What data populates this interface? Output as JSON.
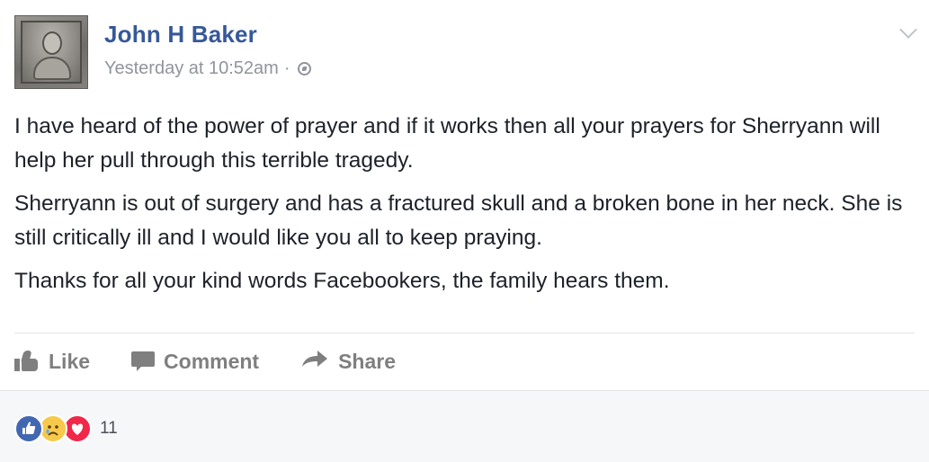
{
  "post": {
    "author_name": "John H Baker",
    "timestamp": "Yesterday at 10:52am",
    "separator": "·",
    "audience_icon": "globe-icon",
    "paragraphs": [
      "I have heard of the power of prayer and if it works then all your prayers for Sherryann will help her pull through this terrible tragedy.",
      "Sherryann is out of surgery and has a fractured skull and a broken bone in her neck. She is still critically ill and I would like you all to keep praying.",
      "Thanks for all your kind words Facebookers, the family hears them."
    ]
  },
  "actions": {
    "like_label": "Like",
    "comment_label": "Comment",
    "share_label": "Share"
  },
  "reactions": {
    "icons": [
      "like-reaction-icon",
      "sad-reaction-icon",
      "love-reaction-icon"
    ],
    "count": "11"
  },
  "colors": {
    "author_link": "#365899",
    "meta_gray": "#90949c",
    "action_gray": "#7f7f7f",
    "like_blue": "#4267b2",
    "sad_yellow": "#f7c94b",
    "love_red": "#f0284a",
    "footer_bg": "#f6f7f9"
  }
}
